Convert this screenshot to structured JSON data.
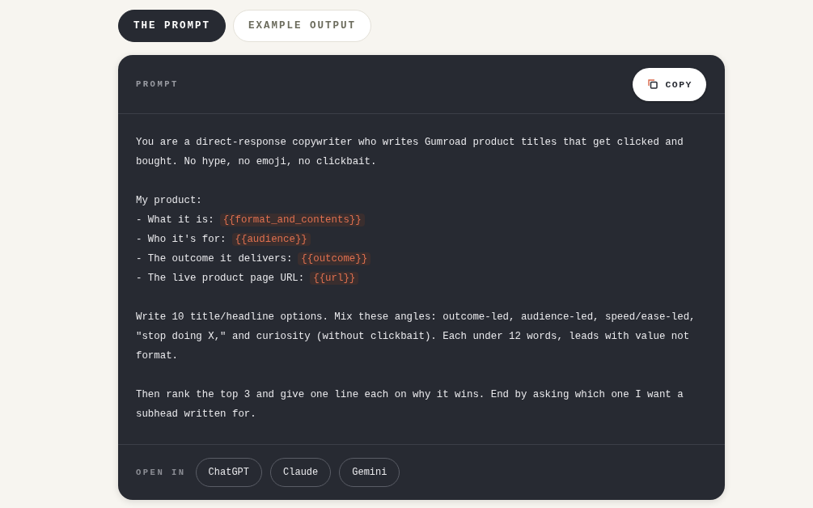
{
  "tabs": [
    {
      "label": "THE PROMPT",
      "selected": true
    },
    {
      "label": "EXAMPLE OUTPUT",
      "selected": false
    }
  ],
  "card": {
    "title": "PROMPT",
    "copy_button": "COPY",
    "blocks": [
      {
        "kind": "paragraph",
        "text": "You are a direct-response copywriter who writes Gumroad product titles that get clicked and bought. No hype, no emoji, no clickbait."
      },
      {
        "kind": "list",
        "intro": "My product:",
        "items": [
          {
            "label": "- What it is:",
            "variable": "{{format_and_contents}}"
          },
          {
            "label": "- Who it's for:",
            "variable": "{{audience}}"
          },
          {
            "label": "- The outcome it delivers:",
            "variable": "{{outcome}}"
          },
          {
            "label": "- The live product page URL:",
            "variable": "{{url}}"
          }
        ]
      },
      {
        "kind": "paragraph",
        "text": "Write 10 title/headline options. Mix these angles: outcome-led, audience-led, speed/ease-led, \"stop doing X,\" and curiosity (without clickbait). Each under 12 words, leads with value not format."
      },
      {
        "kind": "paragraph",
        "text": "Then rank the top 3 and give one line each on why it wins. End by asking which one I want a subhead written for."
      }
    ],
    "open_in_label": "OPEN IN",
    "open_in": [
      "ChatGPT",
      "Claude",
      "Gemini"
    ]
  }
}
